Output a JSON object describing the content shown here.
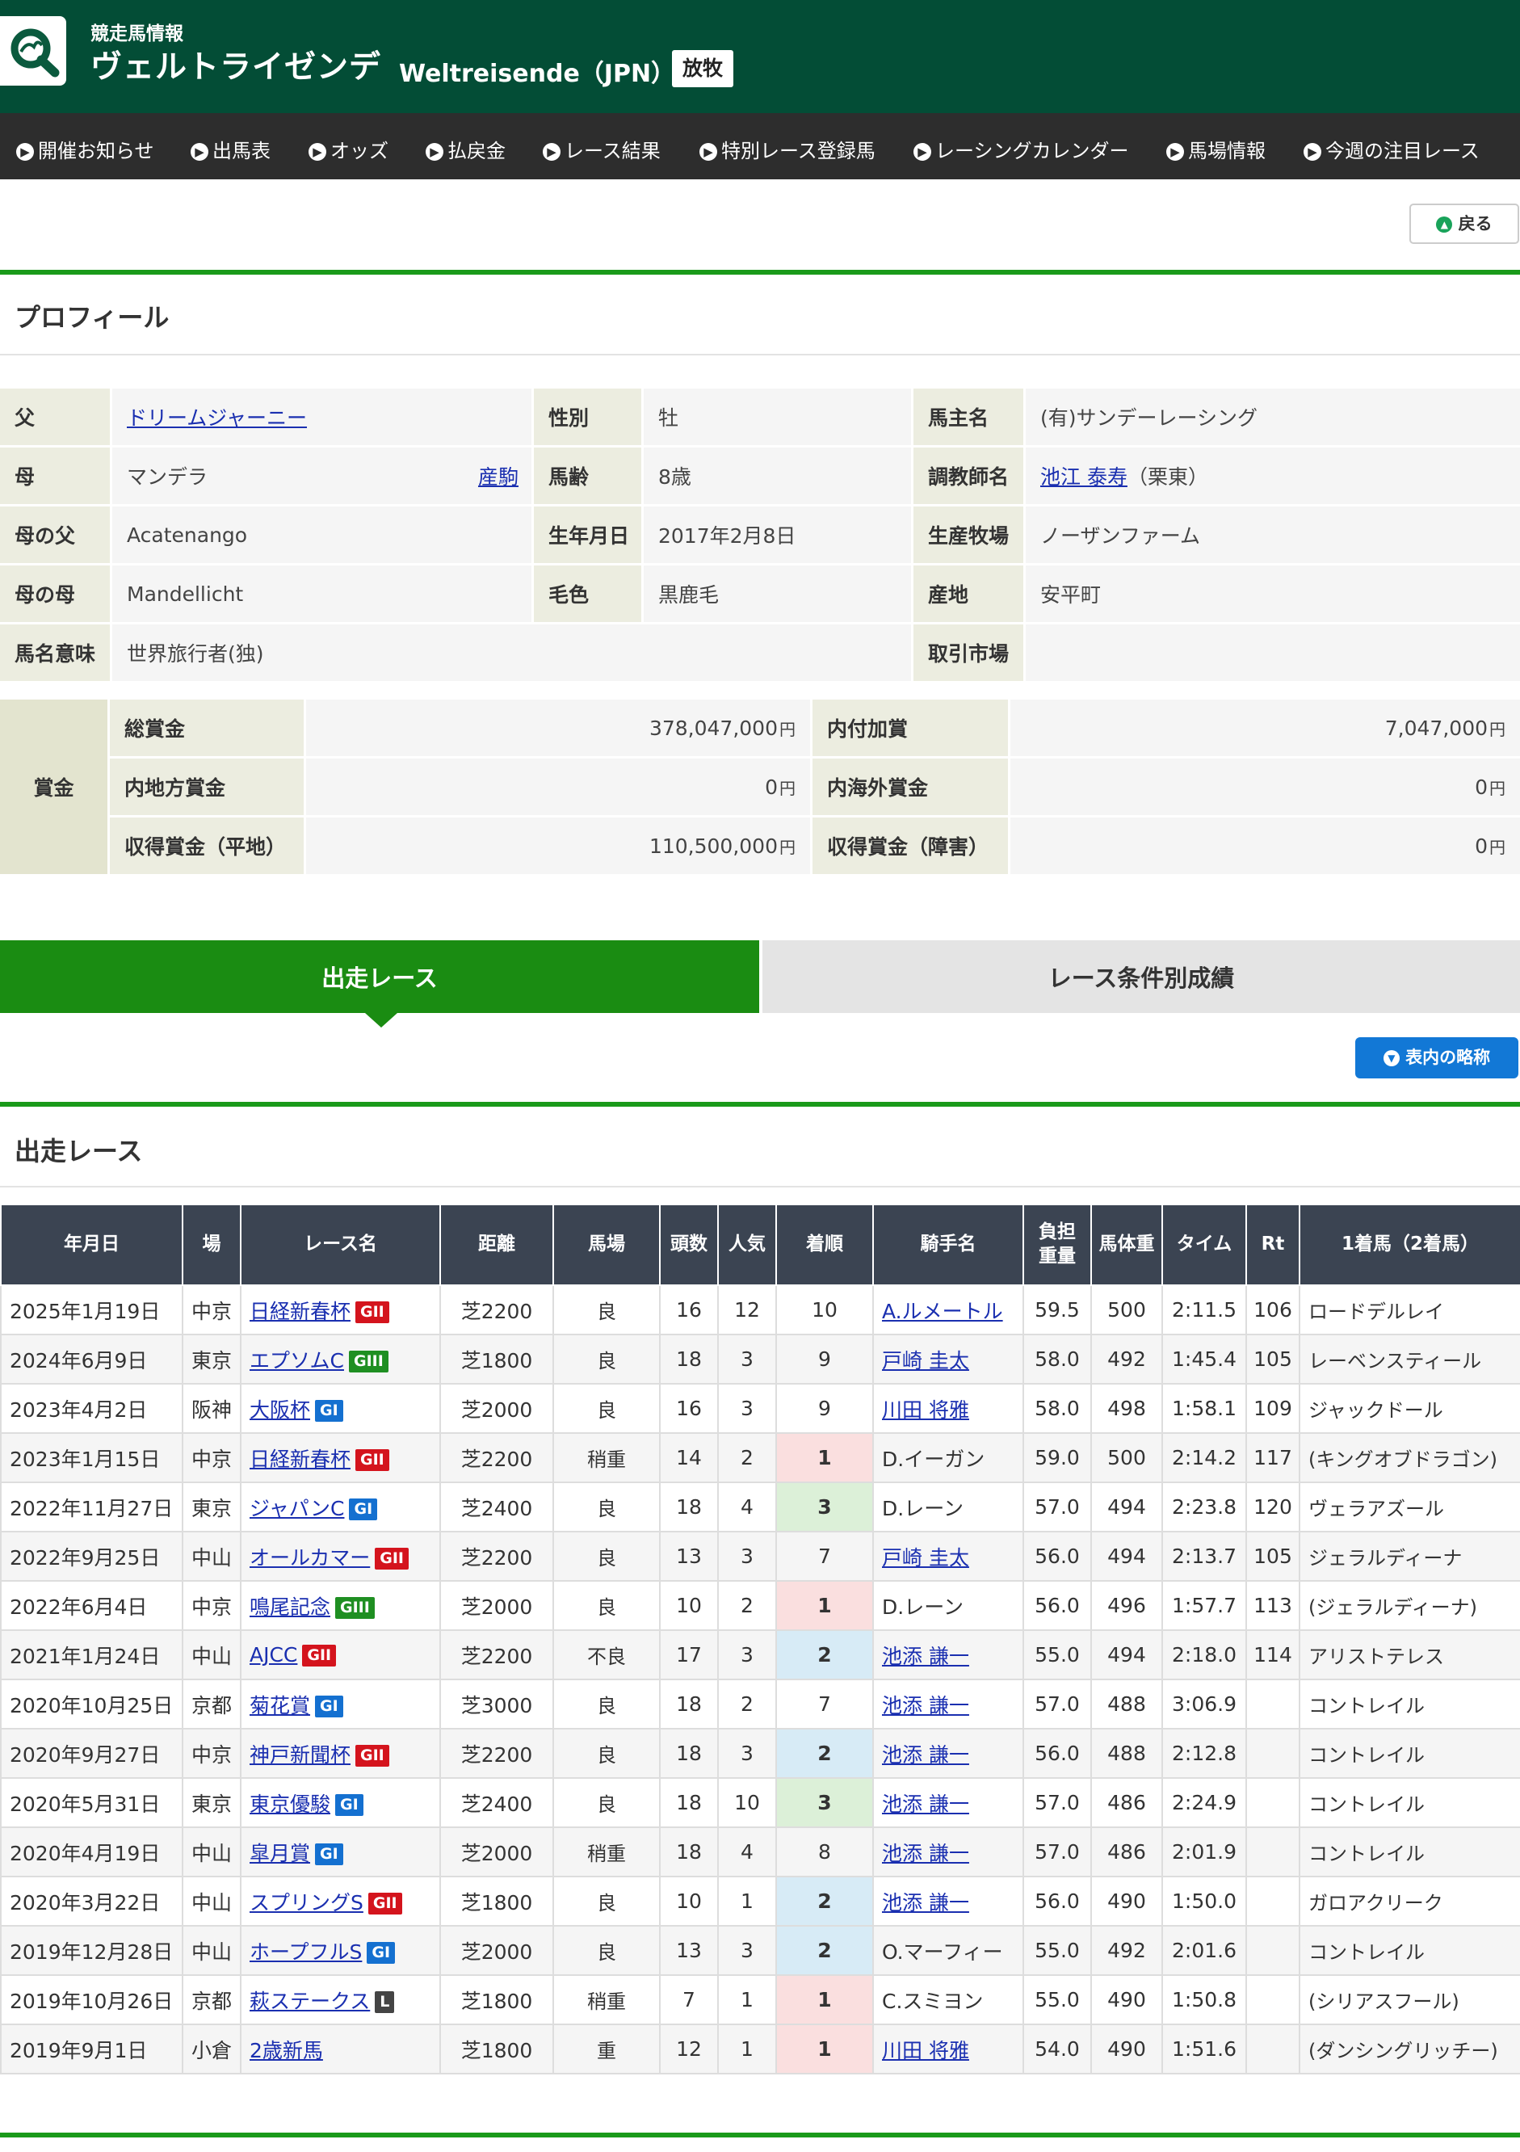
{
  "header": {
    "subtitle": "競走馬情報",
    "name_jp": "ヴェルトライゼンデ",
    "name_en": "Weltreisende（JPN）",
    "status": "放牧",
    "logo": "search-magnifier-logo"
  },
  "nav": [
    "開催お知らせ",
    "出馬表",
    "オッズ",
    "払戻金",
    "レース結果",
    "特別レース登録馬",
    "レーシングカレンダー",
    "馬場情報",
    "今週の注目レース"
  ],
  "back": "戻る",
  "profile": {
    "title": "プロフィール",
    "sire_label": "父",
    "sire": "ドリームジャーニー",
    "dam_label": "母",
    "dam": "マンデラ",
    "dam_link": "産駒",
    "damsire_label": "母の父",
    "damsire": "Acatenango",
    "damdam_label": "母の母",
    "damdam": "Mandellicht",
    "meaning_label": "馬名意味",
    "meaning": "世界旅行者(独)",
    "sex_label": "性別",
    "sex": "牡",
    "age_label": "馬齢",
    "age": "8歳",
    "birth_label": "生年月日",
    "birth": "2017年2月8日",
    "color_label": "毛色",
    "color": "黒鹿毛",
    "owner_label": "馬主名",
    "owner": "(有)サンデーレーシング",
    "trainer_label": "調教師名",
    "trainer": "池江 泰寿",
    "trainer_region": "（栗東）",
    "breeder_label": "生産牧場",
    "breeder": "ノーザンファーム",
    "origin_label": "産地",
    "origin": "安平町",
    "market_label": "取引市場",
    "market": ""
  },
  "prize": {
    "label": "賞金",
    "yen": "円",
    "total_label": "総賞金",
    "total": "378,047,000",
    "add_label": "内付加賞",
    "add": "7,047,000",
    "local_label": "内地方賞金",
    "local": "0",
    "overseas_label": "内海外賞金",
    "overseas": "0",
    "flat_label": "収得賞金（平地）",
    "flat": "110,500,000",
    "jump_label": "収得賞金（障害）",
    "jump": "0"
  },
  "tabs": [
    "出走レース",
    "レース条件別成績"
  ],
  "abbr_button": "表内の略称",
  "races_title": "出走レース",
  "columns": [
    "年月日",
    "場",
    "レース名",
    "距離",
    "馬場",
    "頭数",
    "人気",
    "着順",
    "騎手名",
    "負担\n重量",
    "馬体重",
    "タイム",
    "Rt",
    "1着馬（2着馬）"
  ],
  "races": [
    {
      "date": "2025年1月19日",
      "venue": "中京",
      "race": "日経新春杯",
      "grade": "GII",
      "dist": "芝2200",
      "cond": "良",
      "heads": "16",
      "pop": "12",
      "pos": "10",
      "jockey": "A.ルメートル",
      "jlink": true,
      "wt": "59.5",
      "bw": "500",
      "time": "2:11.5",
      "rt": "106",
      "winner": "ロードデルレイ"
    },
    {
      "date": "2024年6月9日",
      "venue": "東京",
      "race": "エプソムC",
      "grade": "GIII",
      "dist": "芝1800",
      "cond": "良",
      "heads": "18",
      "pop": "3",
      "pos": "9",
      "jockey": "戸崎 圭太",
      "jlink": true,
      "wt": "58.0",
      "bw": "492",
      "time": "1:45.4",
      "rt": "105",
      "winner": "レーベンスティール"
    },
    {
      "date": "2023年4月2日",
      "venue": "阪神",
      "race": "大阪杯",
      "grade": "GI",
      "dist": "芝2000",
      "cond": "良",
      "heads": "16",
      "pop": "3",
      "pos": "9",
      "jockey": "川田 将雅",
      "jlink": true,
      "wt": "58.0",
      "bw": "498",
      "time": "1:58.1",
      "rt": "109",
      "winner": "ジャックドール"
    },
    {
      "date": "2023年1月15日",
      "venue": "中京",
      "race": "日経新春杯",
      "grade": "GII",
      "dist": "芝2200",
      "cond": "稍重",
      "heads": "14",
      "pop": "2",
      "pos": "1",
      "jockey": "D.イーガン",
      "jlink": false,
      "wt": "59.0",
      "bw": "500",
      "time": "2:14.2",
      "rt": "117",
      "winner": "(キングオブドラゴン)"
    },
    {
      "date": "2022年11月27日",
      "venue": "東京",
      "race": "ジャパンC",
      "grade": "GI",
      "dist": "芝2400",
      "cond": "良",
      "heads": "18",
      "pop": "4",
      "pos": "3",
      "jockey": "D.レーン",
      "jlink": false,
      "wt": "57.0",
      "bw": "494",
      "time": "2:23.8",
      "rt": "120",
      "winner": "ヴェラアズール"
    },
    {
      "date": "2022年9月25日",
      "venue": "中山",
      "race": "オールカマー",
      "grade": "GII",
      "dist": "芝2200",
      "cond": "良",
      "heads": "13",
      "pop": "3",
      "pos": "7",
      "jockey": "戸崎 圭太",
      "jlink": true,
      "wt": "56.0",
      "bw": "494",
      "time": "2:13.7",
      "rt": "105",
      "winner": "ジェラルディーナ"
    },
    {
      "date": "2022年6月4日",
      "venue": "中京",
      "race": "鳴尾記念",
      "grade": "GIII",
      "dist": "芝2000",
      "cond": "良",
      "heads": "10",
      "pop": "2",
      "pos": "1",
      "jockey": "D.レーン",
      "jlink": false,
      "wt": "56.0",
      "bw": "496",
      "time": "1:57.7",
      "rt": "113",
      "winner": "(ジェラルディーナ)"
    },
    {
      "date": "2021年1月24日",
      "venue": "中山",
      "race": "AJCC",
      "grade": "GII",
      "dist": "芝2200",
      "cond": "不良",
      "heads": "17",
      "pop": "3",
      "pos": "2",
      "jockey": "池添 謙一",
      "jlink": true,
      "wt": "55.0",
      "bw": "494",
      "time": "2:18.0",
      "rt": "114",
      "winner": "アリストテレス"
    },
    {
      "date": "2020年10月25日",
      "venue": "京都",
      "race": "菊花賞",
      "grade": "GI",
      "dist": "芝3000",
      "cond": "良",
      "heads": "18",
      "pop": "2",
      "pos": "7",
      "jockey": "池添 謙一",
      "jlink": true,
      "wt": "57.0",
      "bw": "488",
      "time": "3:06.9",
      "rt": "",
      "winner": "コントレイル"
    },
    {
      "date": "2020年9月27日",
      "venue": "中京",
      "race": "神戸新聞杯",
      "grade": "GII",
      "dist": "芝2200",
      "cond": "良",
      "heads": "18",
      "pop": "3",
      "pos": "2",
      "jockey": "池添 謙一",
      "jlink": true,
      "wt": "56.0",
      "bw": "488",
      "time": "2:12.8",
      "rt": "",
      "winner": "コントレイル"
    },
    {
      "date": "2020年5月31日",
      "venue": "東京",
      "race": "東京優駿",
      "grade": "GI",
      "dist": "芝2400",
      "cond": "良",
      "heads": "18",
      "pop": "10",
      "pos": "3",
      "jockey": "池添 謙一",
      "jlink": true,
      "wt": "57.0",
      "bw": "486",
      "time": "2:24.9",
      "rt": "",
      "winner": "コントレイル"
    },
    {
      "date": "2020年4月19日",
      "venue": "中山",
      "race": "皐月賞",
      "grade": "GI",
      "dist": "芝2000",
      "cond": "稍重",
      "heads": "18",
      "pop": "4",
      "pos": "8",
      "jockey": "池添 謙一",
      "jlink": true,
      "wt": "57.0",
      "bw": "486",
      "time": "2:01.9",
      "rt": "",
      "winner": "コントレイル"
    },
    {
      "date": "2020年3月22日",
      "venue": "中山",
      "race": "スプリングS",
      "grade": "GII",
      "dist": "芝1800",
      "cond": "良",
      "heads": "10",
      "pop": "1",
      "pos": "2",
      "jockey": "池添 謙一",
      "jlink": true,
      "wt": "56.0",
      "bw": "490",
      "time": "1:50.0",
      "rt": "",
      "winner": "ガロアクリーク"
    },
    {
      "date": "2019年12月28日",
      "venue": "中山",
      "race": "ホープフルS",
      "grade": "GI",
      "dist": "芝2000",
      "cond": "良",
      "heads": "13",
      "pop": "3",
      "pos": "2",
      "jockey": "O.マーフィー",
      "jlink": false,
      "wt": "55.0",
      "bw": "492",
      "time": "2:01.6",
      "rt": "",
      "winner": "コントレイル"
    },
    {
      "date": "2019年10月26日",
      "venue": "京都",
      "race": "萩ステークス",
      "grade": "L",
      "dist": "芝1800",
      "cond": "稍重",
      "heads": "7",
      "pop": "1",
      "pos": "1",
      "jockey": "C.スミヨン",
      "jlink": false,
      "wt": "55.0",
      "bw": "490",
      "time": "1:50.8",
      "rt": "",
      "winner": "(シリアスフール)"
    },
    {
      "date": "2019年9月1日",
      "venue": "小倉",
      "race": "2歳新馬",
      "grade": "",
      "dist": "芝1800",
      "cond": "重",
      "heads": "12",
      "pop": "1",
      "pos": "1",
      "jockey": "川田 将雅",
      "jlink": true,
      "wt": "54.0",
      "bw": "490",
      "time": "1:51.6",
      "rt": "",
      "winner": "(ダンシングリッチー)"
    }
  ],
  "colors": {
    "header": "#034d36",
    "nav": "#2d2d2d",
    "accent_green": "#1a8c12",
    "table_header": "#3b4452",
    "first": "#fadfdf",
    "second": "#d7ebf6",
    "third": "#dcf0d8"
  }
}
